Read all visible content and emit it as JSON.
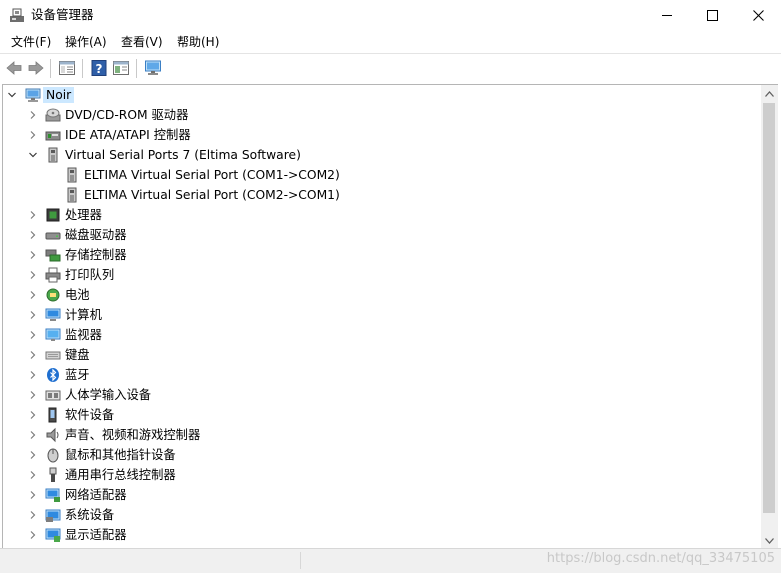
{
  "window": {
    "title": "设备管理器"
  },
  "menu": {
    "file": "文件(F)",
    "action": "操作(A)",
    "view": "查看(V)",
    "help": "帮助(H)"
  },
  "tree": {
    "root": "Noir",
    "nodes": [
      "DVD/CD-ROM 驱动器",
      "IDE ATA/ATAPI 控制器",
      "Virtual Serial Ports 7 (Eltima Software)",
      "ELTIMA Virtual Serial Port (COM1->COM2)",
      "ELTIMA Virtual Serial Port (COM2->COM1)",
      "处理器",
      "磁盘驱动器",
      "存储控制器",
      "打印队列",
      "电池",
      "计算机",
      "监视器",
      "键盘",
      "蓝牙",
      "人体学输入设备",
      "软件设备",
      "声音、视频和游戏控制器",
      "鼠标和其他指针设备",
      "通用串行总线控制器",
      "网络适配器",
      "系统设备",
      "显示适配器"
    ]
  },
  "statusbar": {
    "watermark": "https://blog.csdn.net/qq_33475105"
  }
}
